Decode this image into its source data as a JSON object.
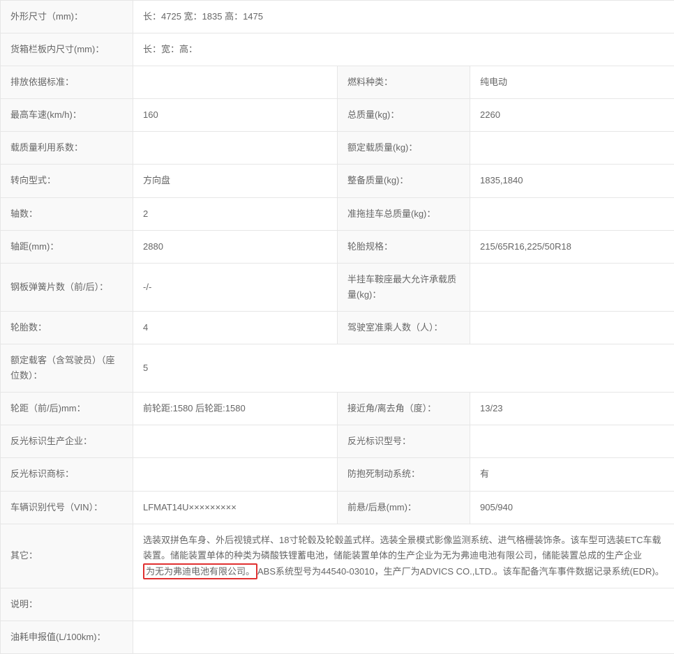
{
  "rows": [
    {
      "type": "full",
      "label": "外形尺寸（mm)：",
      "value": "长：4725 宽：1835 高：1475"
    },
    {
      "type": "full",
      "label": "货箱栏板内尺寸(mm)：",
      "value": "长：宽：高："
    },
    {
      "type": "pair",
      "label1": "排放依据标准：",
      "value1": "",
      "label2": "燃料种类：",
      "value2": "纯电动"
    },
    {
      "type": "pair",
      "label1": "最高车速(km/h)：",
      "value1": "160",
      "label2": "总质量(kg)：",
      "value2": "2260"
    },
    {
      "type": "pair",
      "label1": "载质量利用系数：",
      "value1": "",
      "label2": "额定载质量(kg)：",
      "value2": ""
    },
    {
      "type": "pair",
      "label1": "转向型式：",
      "value1": "方向盘",
      "label2": "整备质量(kg)：",
      "value2": "1835,1840"
    },
    {
      "type": "pair",
      "label1": "轴数：",
      "value1": "2",
      "label2": "准拖挂车总质量(kg)：",
      "value2": ""
    },
    {
      "type": "pair",
      "label1": "轴距(mm)：",
      "value1": "2880",
      "label2": "轮胎规格：",
      "value2": "215/65R16,225/50R18"
    },
    {
      "type": "pair",
      "label1": "钢板弹簧片数（前/后）：",
      "value1": "-/-",
      "label2": "半挂车鞍座最大允许承载质量(kg)：",
      "value2": ""
    },
    {
      "type": "pair",
      "label1": "轮胎数：",
      "value1": "4",
      "label2": "驾驶室准乘人数（人）：",
      "value2": ""
    },
    {
      "type": "full",
      "label": "额定载客（含驾驶员）（座位数）：",
      "value": "5"
    },
    {
      "type": "pair",
      "label1": "轮距（前/后)mm：",
      "value1": "前轮距:1580 后轮距:1580",
      "label2": "接近角/离去角（度）：",
      "value2": "13/23"
    },
    {
      "type": "pair",
      "label1": "反光标识生产企业：",
      "value1": "",
      "label2": "反光标识型号：",
      "value2": ""
    },
    {
      "type": "pair",
      "label1": "反光标识商标：",
      "value1": "",
      "label2": "防抱死制动系统：",
      "value2": "有"
    },
    {
      "type": "pair",
      "label1": "车辆识别代号（VIN）：",
      "value1": "LFMAT14U×××××××××",
      "label2": "前悬/后悬(mm)：",
      "value2": "905/940"
    }
  ],
  "others": {
    "label": "其它：",
    "pre": "选装双拼色车身、外后视镜式样、18寸轮毂及轮毂盖式样。选装全景模式影像监测系统、进气格栅装饰条。该车型可选装ETC车载装置。储能装置单体的种类为磷酸铁锂蓄电池，储能装置单体的生产企业为无为弗迪电池有限公司，储能装置总成的生产企业",
    "highlight": "为无为弗迪电池有限公司。",
    "post": "ABS系统型号为44540-03010，生产厂为ADVICS CO.,LTD.。该车配备汽车事件数据记录系统(EDR)。"
  },
  "explain": {
    "label": "说明：",
    "value": ""
  },
  "fuel": {
    "label": "油耗申报值(L/100km)：",
    "value": ""
  }
}
